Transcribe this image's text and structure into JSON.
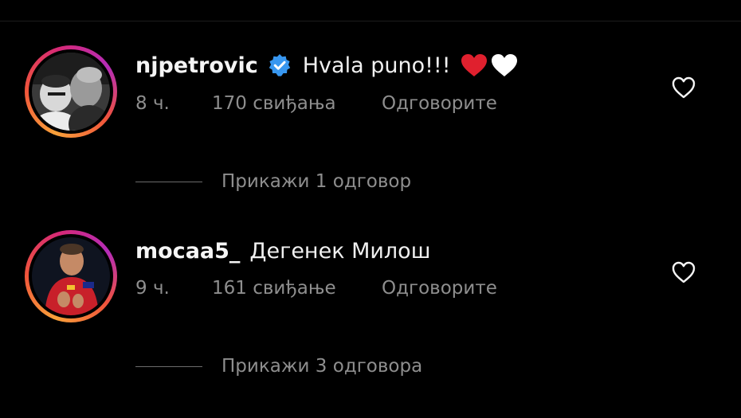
{
  "comments": [
    {
      "username": "njpetrovic",
      "verified": true,
      "text": "Hvala puno!!!",
      "emoji": [
        "❤️",
        "🤍"
      ],
      "time": "8 ч.",
      "likes": "170 свиђања",
      "reply_label": "Одговорите",
      "view_replies": "Прикажи 1 одговор"
    },
    {
      "username": "mocaa5_",
      "verified": false,
      "text": "Дегенек Милош",
      "time": "9 ч.",
      "likes": "161 свиђање",
      "reply_label": "Одговорите",
      "view_replies": "Прикажи 3 одговора"
    }
  ],
  "icons": {
    "verified": "verified-badge-icon",
    "like": "heart-outline-icon"
  },
  "colors": {
    "background": "#000000",
    "primary_text": "#f5f5f5",
    "secondary_text": "#8e8e8e",
    "verified_blue": "#3897f0",
    "red_heart": "#e0202e",
    "white_heart": "#ffffff"
  }
}
